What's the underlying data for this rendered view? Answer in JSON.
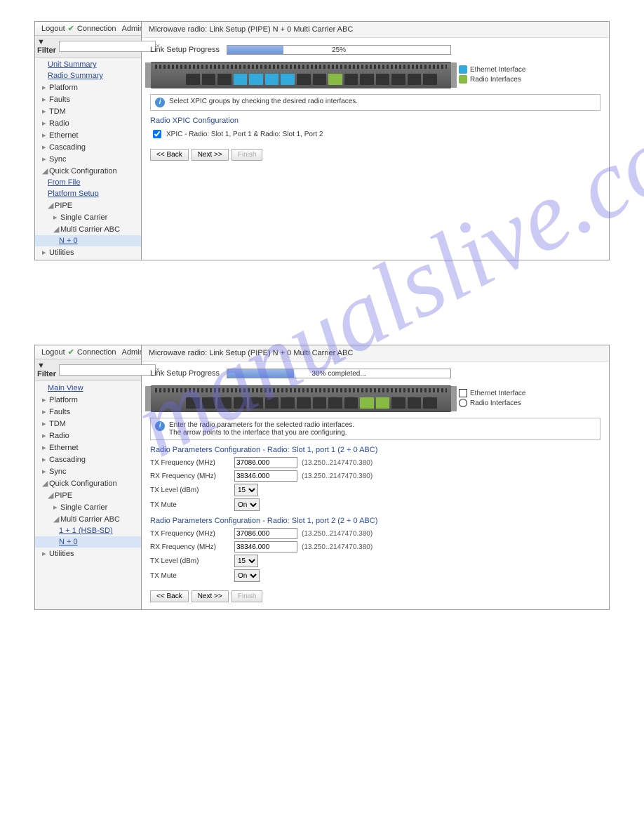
{
  "watermark": "manualslive.com",
  "header": {
    "logout": "Logout",
    "connection": "Connection",
    "admin": "Admin",
    "filter_label": "▼ Filter",
    "clear": "×"
  },
  "legend": {
    "eth": "Ethernet Interface",
    "rad": "Radio Interfaces"
  },
  "buttons": {
    "back": "<< Back",
    "next": "Next >>",
    "finish": "Finish"
  },
  "panel1": {
    "title": "Microwave radio: Link Setup (PIPE) N + 0 Multi Carrier ABC",
    "progress_label": "Link Setup Progress",
    "progress_pct": 25,
    "progress_text": "25%",
    "info": "Select XPIC groups by checking the desired radio interfaces.",
    "section": "Radio XPIC Configuration",
    "xpic_label": "XPIC - Radio: Slot 1, Port 1 & Radio: Slot 1, Port 2",
    "tree": [
      {
        "label": "Unit Summary",
        "link": true,
        "lvl": 1
      },
      {
        "label": "Radio Summary",
        "link": true,
        "lvl": 1
      },
      {
        "label": "Platform",
        "tw": "▸",
        "lvl": 0
      },
      {
        "label": "Faults",
        "tw": "▸",
        "lvl": 0
      },
      {
        "label": "TDM",
        "tw": "▸",
        "lvl": 0
      },
      {
        "label": "Radio",
        "tw": "▸",
        "lvl": 0
      },
      {
        "label": "Ethernet",
        "tw": "▸",
        "lvl": 0
      },
      {
        "label": "Cascading",
        "tw": "▸",
        "lvl": 0
      },
      {
        "label": "Sync",
        "tw": "▸",
        "lvl": 0
      },
      {
        "label": "Quick Configuration",
        "tw": "◢",
        "lvl": 0
      },
      {
        "label": "From File",
        "link": true,
        "lvl": 1
      },
      {
        "label": "Platform Setup",
        "link": true,
        "lvl": 1
      },
      {
        "label": "PIPE",
        "tw": "◢",
        "lvl": 1
      },
      {
        "label": "Single Carrier",
        "tw": "▸",
        "lvl": 2
      },
      {
        "label": "Multi Carrier ABC",
        "tw": "◢",
        "lvl": 2
      },
      {
        "label": "N + 0",
        "link": true,
        "sel": true,
        "lvl": 3
      },
      {
        "label": "Utilities",
        "tw": "▸",
        "lvl": 0
      }
    ]
  },
  "panel2": {
    "title": "Microwave radio: Link Setup (PIPE) N + 0 Multi Carrier ABC",
    "progress_label": "Link Setup Progress",
    "progress_pct": 30,
    "progress_text": "30% completed...",
    "info": "Enter the radio parameters for the selected radio interfaces.\nThe arrow points to the interface that you are configuring.",
    "section1": "Radio Parameters Configuration - Radio: Slot 1, port 1 (2 + 0 ABC)",
    "section2": "Radio Parameters Configuration - Radio: Slot 1, port 2 (2 + 0 ABC)",
    "fields": {
      "txfreq": {
        "label": "TX Frequency (MHz)",
        "value": "37086.000",
        "range": "(13.250..2147470.380)"
      },
      "rxfreq": {
        "label": "RX Frequency (MHz)",
        "value": "38346.000",
        "range": "(13.250..2147470.380)"
      },
      "txlevel": {
        "label": "TX Level (dBm)",
        "value": "15"
      },
      "txmute": {
        "label": "TX Mute",
        "value": "On"
      }
    },
    "tree": [
      {
        "label": "Main View",
        "link": true,
        "lvl": 1
      },
      {
        "label": "Platform",
        "tw": "▸",
        "lvl": 0
      },
      {
        "label": "Faults",
        "tw": "▸",
        "lvl": 0
      },
      {
        "label": "TDM",
        "tw": "▸",
        "lvl": 0
      },
      {
        "label": "Radio",
        "tw": "▸",
        "lvl": 0
      },
      {
        "label": "Ethernet",
        "tw": "▸",
        "lvl": 0
      },
      {
        "label": "Cascading",
        "tw": "▸",
        "lvl": 0
      },
      {
        "label": "Sync",
        "tw": "▸",
        "lvl": 0
      },
      {
        "label": "Quick Configuration",
        "tw": "◢",
        "lvl": 0
      },
      {
        "label": "PIPE",
        "tw": "◢",
        "lvl": 1
      },
      {
        "label": "Single Carrier",
        "tw": "▸",
        "lvl": 2
      },
      {
        "label": "Multi Carrier ABC",
        "tw": "◢",
        "lvl": 2
      },
      {
        "label": "1 + 1 (HSB-SD)",
        "link": true,
        "lvl": 3
      },
      {
        "label": "N + 0",
        "link": true,
        "sel": true,
        "lvl": 3
      },
      {
        "label": "Utilities",
        "tw": "▸",
        "lvl": 0
      }
    ]
  }
}
